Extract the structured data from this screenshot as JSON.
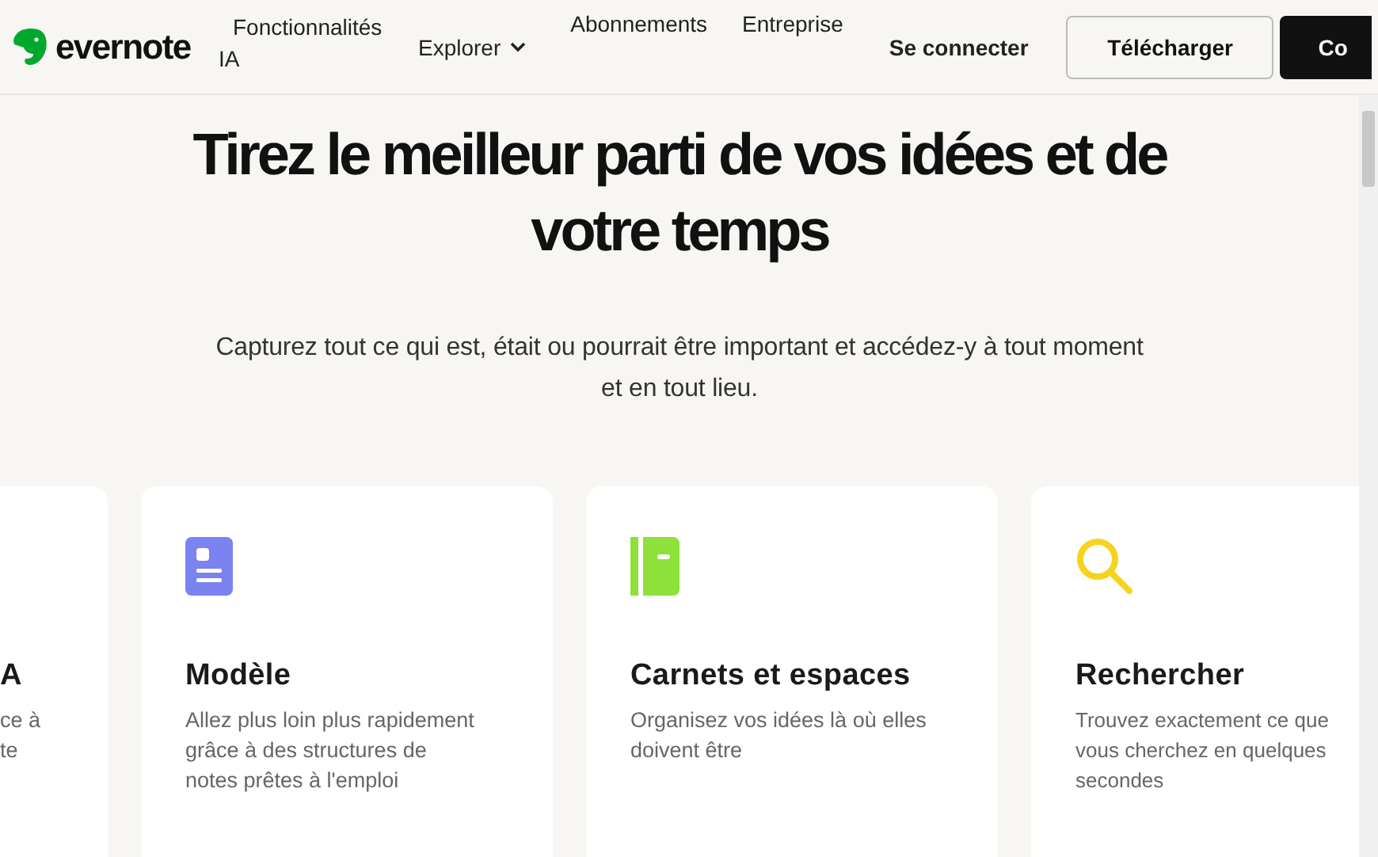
{
  "header": {
    "logo": "evernote",
    "nav": [
      {
        "kind": "link",
        "label": "Fonctionnalités IA"
      },
      {
        "kind": "dropdown",
        "label": "Explorer"
      },
      {
        "kind": "link",
        "label": "Abonnements"
      },
      {
        "kind": "link",
        "label": "Entreprise"
      }
    ],
    "login": "Se connecter",
    "download": "Télécharger",
    "cta": "Co"
  },
  "hero": {
    "title": "Tirez le meilleur parti de vos idées et de votre temps",
    "subtitle": "Capturez tout ce qui est, était ou pourrait être important et accédez-y à tout moment et en tout lieu."
  },
  "features": [
    {
      "kind": "none",
      "title": "A",
      "lines": [
        "ce à",
        "te"
      ]
    },
    {
      "kind": "template",
      "title": "Modèle",
      "lines": [
        "Allez plus loin plus rapidement",
        "grâce à des structures de",
        "notes prêtes à l'emploi"
      ]
    },
    {
      "kind": "notebook",
      "title": "Carnets et espaces",
      "lines": [
        "Organisez vos idées là où elles",
        "doivent être"
      ]
    },
    {
      "kind": "search",
      "title": "Rechercher",
      "lines": [
        "Trouvez exactement ce que",
        "vous cherchez en quelques",
        "secondes"
      ]
    }
  ]
}
